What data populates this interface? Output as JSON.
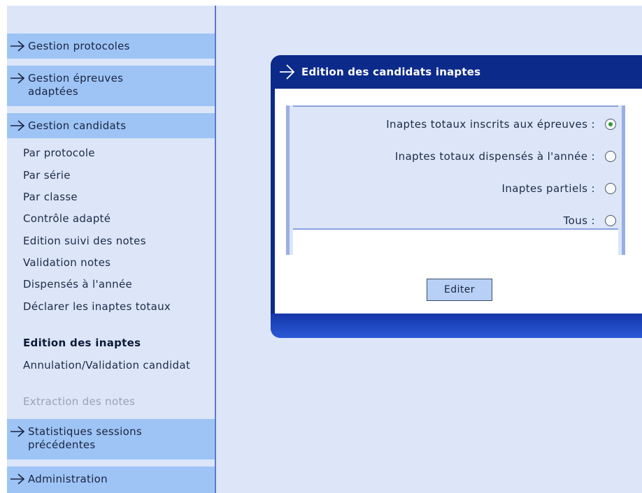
{
  "sidebar": {
    "sections": [
      {
        "label": "Gestion protocoles"
      },
      {
        "label": "Gestion épreuves adaptées"
      },
      {
        "label": "Gestion candidats"
      },
      {
        "label": "Statistiques sessions précédentes"
      },
      {
        "label": "Administration"
      }
    ],
    "submenu": [
      {
        "label": "Par protocole"
      },
      {
        "label": "Par série"
      },
      {
        "label": "Par classe"
      },
      {
        "label": "Contrôle adapté"
      },
      {
        "label": "Edition suivi des notes"
      },
      {
        "label": "Validation notes"
      },
      {
        "label": "Dispensés à l'année"
      },
      {
        "label": "Déclarer les inaptes totaux"
      },
      {
        "label": "Edition des inaptes",
        "state": "active"
      },
      {
        "label": "Annulation/Validation candidat"
      },
      {
        "label": "Extraction des notes",
        "state": "disabled"
      }
    ]
  },
  "panel": {
    "title": "Edition des candidats inaptes",
    "options": [
      {
        "label": "Inaptes totaux inscrits aux épreuves :",
        "checked": true
      },
      {
        "label": "Inaptes totaux dispensés à l'année :",
        "checked": false
      },
      {
        "label": "Inaptes partiels :",
        "checked": false
      },
      {
        "label": "Tous :",
        "checked": false
      }
    ],
    "button_label": "Editer"
  },
  "icons": {
    "section_arrow": "arrow-right-icon",
    "panel_arrow": "arrow-right-icon",
    "radio": "radio-button"
  },
  "colors": {
    "sidebar_bg": "#dce6f8",
    "section_bg": "#9ec4f6",
    "panel_header": "#0c2a8a",
    "radio_selected": "#2e9a2e"
  }
}
